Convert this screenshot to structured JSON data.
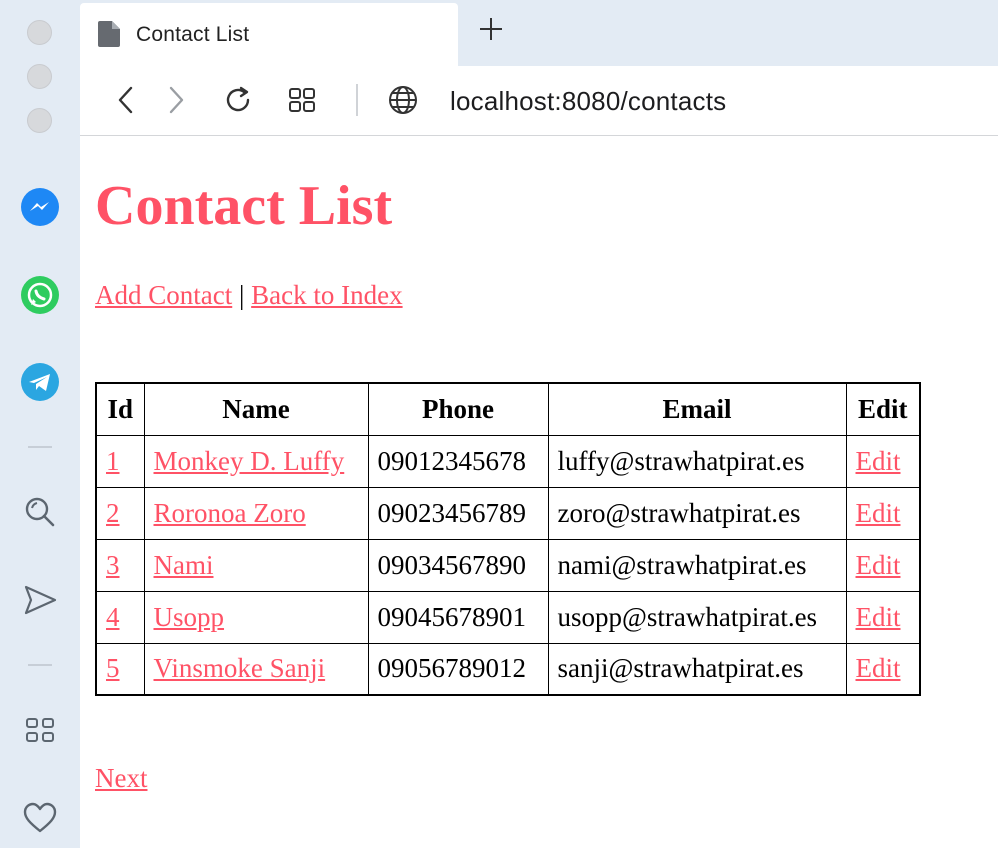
{
  "browser": {
    "tab_title": "Contact List",
    "url": "localhost:8080/contacts"
  },
  "sidebar": {
    "items": [
      {
        "icon": "messenger-icon"
      },
      {
        "icon": "whatsapp-icon"
      },
      {
        "icon": "telegram-icon"
      },
      {
        "icon": "search-icon"
      },
      {
        "icon": "send-icon"
      },
      {
        "icon": "apps-grid-icon"
      },
      {
        "icon": "heart-icon"
      }
    ]
  },
  "colors": {
    "accent": "#ff5266",
    "sidebar_bg": "#e3ebf4"
  },
  "page": {
    "title": "Contact List",
    "add_contact_label": "Add Contact",
    "separator": "|",
    "back_label": "Back to Index",
    "next_label": "Next"
  },
  "table": {
    "headers": [
      "Id",
      "Name",
      "Phone",
      "Email",
      "Edit"
    ],
    "rows": [
      {
        "id": "1",
        "name": "Monkey D. Luffy",
        "phone": "09012345678",
        "email": "luffy@strawhatpirat.es",
        "edit": "Edit"
      },
      {
        "id": "2",
        "name": "Roronoa Zoro",
        "phone": "09023456789",
        "email": "zoro@strawhatpirat.es",
        "edit": "Edit"
      },
      {
        "id": "3",
        "name": "Nami",
        "phone": "09034567890",
        "email": "nami@strawhatpirat.es",
        "edit": "Edit"
      },
      {
        "id": "4",
        "name": "Usopp",
        "phone": "09045678901",
        "email": "usopp@strawhatpirat.es",
        "edit": "Edit"
      },
      {
        "id": "5",
        "name": "Vinsmoke Sanji",
        "phone": "09056789012",
        "email": "sanji@strawhatpirat.es",
        "edit": "Edit"
      }
    ]
  }
}
